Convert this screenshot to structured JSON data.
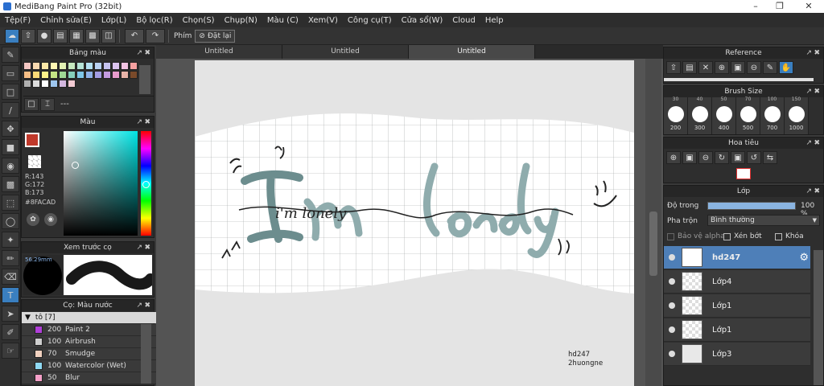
{
  "window": {
    "title": "MediBang Paint Pro (32bit)"
  },
  "menu": [
    "Tệp(F)",
    "Chỉnh sửa(E)",
    "Lớp(L)",
    "Bộ lọc(R)",
    "Chọn(S)",
    "Chụp(N)",
    "Màu (C)",
    "Xem(V)",
    "Công cụ(T)",
    "Cửa sổ(W)",
    "Cloud",
    "Help"
  ],
  "toolbar": {
    "shortcut_label": "Phím",
    "reset_label": "Đặt lại"
  },
  "palette": {
    "title": "Bảng màu",
    "colors": [
      "#f4c7c3",
      "#f8d9b0",
      "#fbe8a6",
      "#fff7b3",
      "#e3f2b4",
      "#c7e9c0",
      "#b5e3d7",
      "#b3e0f2",
      "#b8d1f2",
      "#c6c3f0",
      "#dcc3ef",
      "#f2c3e2",
      "#f5a0a0",
      "#f7be85",
      "#fbd977",
      "#fff28a",
      "#c6e585",
      "#9fd995",
      "#86d0bb",
      "#7fc7e8",
      "#8fb2e8",
      "#a39de3",
      "#c39be0",
      "#e89bcc",
      "#e8b3a8",
      "#7a4a2a",
      "#b0b0b0",
      "#dcdcdc",
      "#ffffff",
      "#9ec6ef",
      "#d4b8e0",
      "#f3cbd3"
    ],
    "status": "---"
  },
  "color_panel": {
    "title": "Màu",
    "r": "R:143",
    "g": "G:172",
    "b": "B:173",
    "hex": "#8FACAD",
    "accent": "#8FACAD"
  },
  "preview": {
    "title": "Xem trước cọ",
    "size": "56.29mm"
  },
  "brush_panel": {
    "title": "Cọ: Màu nước",
    "group": "tô [7]",
    "brushes": [
      {
        "size": "200",
        "name": "Paint 2",
        "color": "#b03fd8"
      },
      {
        "size": "100",
        "name": "Airbrush",
        "color": "#cfcfcf"
      },
      {
        "size": "70",
        "name": "Smudge",
        "color": "#f2d2c0"
      },
      {
        "size": "100",
        "name": "Watercolor (Wet)",
        "color": "#8fd9f3"
      },
      {
        "size": "50",
        "name": "Blur",
        "color": "#f5a0c8"
      }
    ]
  },
  "tabs": [
    "Untitled",
    "Untitled",
    "Untitled"
  ],
  "canvas": {
    "words": "I'm lonely",
    "line_text": "i'm lonely",
    "signature_1": "hd247",
    "signature_2": "2huongne"
  },
  "reference": {
    "title": "Reference"
  },
  "brush_size": {
    "title": "Brush Size",
    "top_labels": [
      "30",
      "40",
      "50",
      "70",
      "100",
      "150"
    ],
    "labels": [
      "200",
      "300",
      "400",
      "500",
      "700",
      "1000"
    ]
  },
  "navigator": {
    "title": "Hoa tiêu"
  },
  "layers": {
    "title": "Lớp",
    "opacity_label": "Độ trong",
    "opacity_value": "100 %",
    "opacity": 1.0,
    "blend_label": "Pha trộn",
    "blend_value": "Bình thường",
    "protect_alpha": "Bảo vệ alpha",
    "clipping": "Xén bớt",
    "lock": "Khóa",
    "items": [
      "hd247",
      "Lớp4",
      "Lớp1",
      "Lớp1",
      "Lớp3"
    ]
  }
}
